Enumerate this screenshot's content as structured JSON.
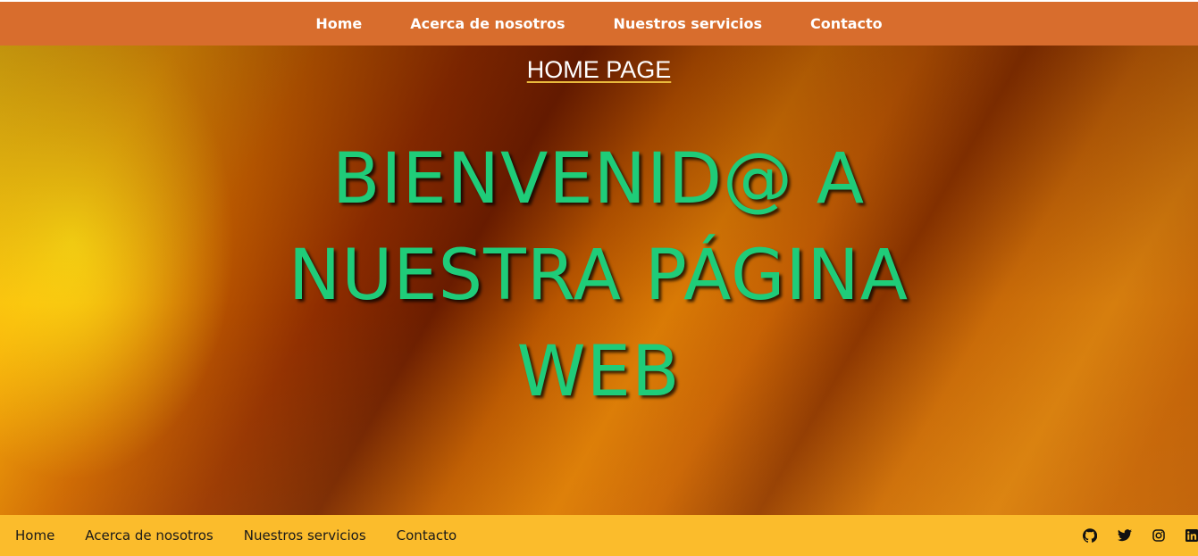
{
  "top_nav": {
    "items": [
      "Home",
      "Acerca de nosotros",
      "Nuestros servicios",
      "Contacto"
    ]
  },
  "hero": {
    "subtitle": "HOME PAGE",
    "title": "BIENVENID@ A NUESTRA PÁGINA WEB"
  },
  "footer": {
    "items": [
      "Home",
      "Acerca de nosotros",
      "Nuestros servicios",
      "Contacto"
    ],
    "social_icons": [
      "github-icon",
      "twitter-icon",
      "instagram-icon",
      "linkedin-icon"
    ]
  },
  "colors": {
    "top_nav_bg": "#d86d2d",
    "footer_bg": "#fbbc2c",
    "title_text": "#1fcc79"
  }
}
